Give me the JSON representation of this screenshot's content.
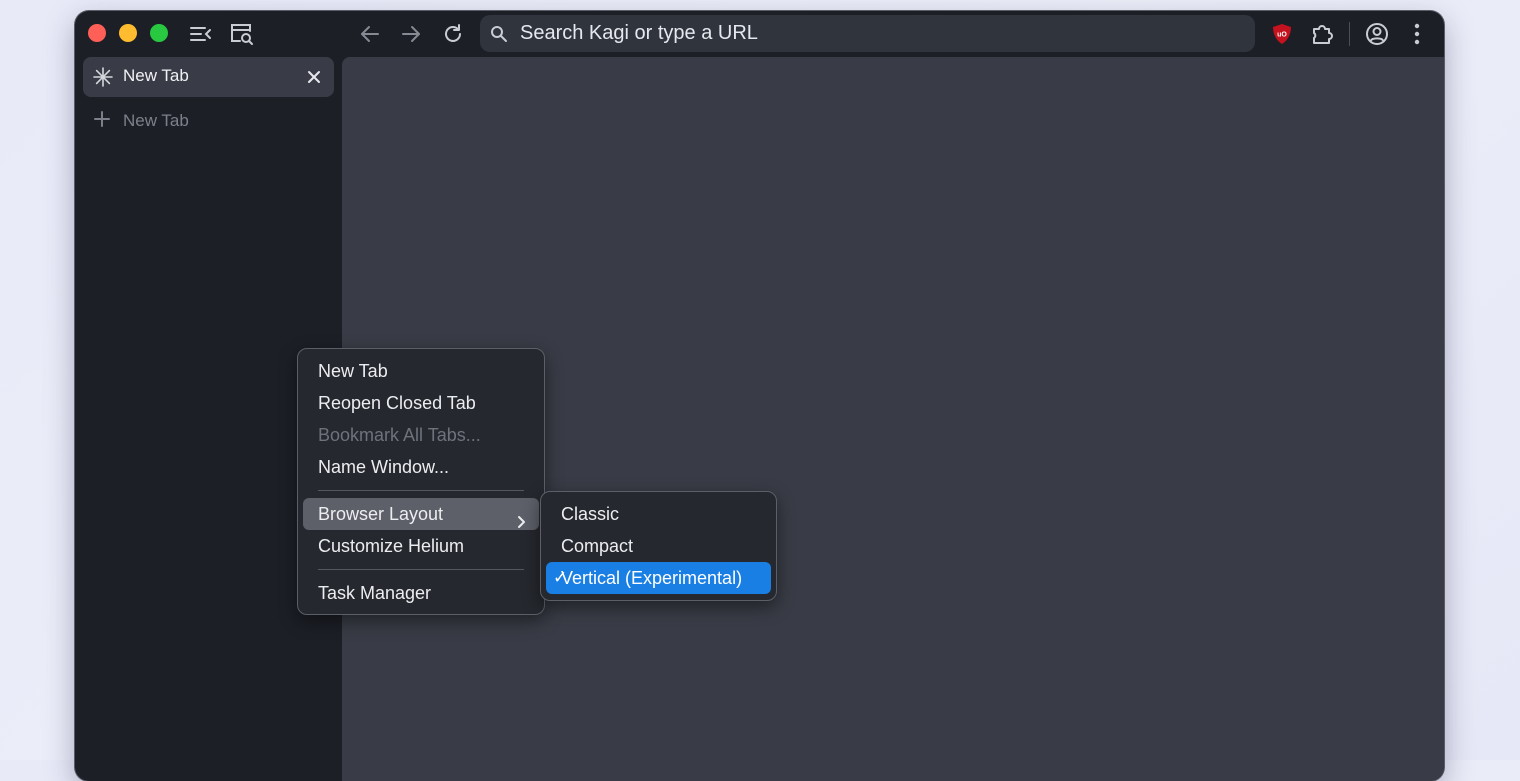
{
  "window": {
    "traffic_lights": {
      "close": "#fe5f57",
      "minimize": "#febc2e",
      "maximize": "#28c840"
    }
  },
  "toolbar": {
    "icons": [
      "sidebar-toggle-icon",
      "tab-search-icon",
      "back-arrow-icon",
      "forward-arrow-icon",
      "reload-icon",
      "ublock-origin-icon",
      "extensions-puzzle-icon",
      "profile-icon",
      "more-vert-icon"
    ],
    "url_placeholder": "Search Kagi or type a URL",
    "ublock_color": "#c4121f"
  },
  "sidebar": {
    "tabs": [
      {
        "title": "New Tab",
        "icon": "helium-asterisk-icon",
        "active": true
      }
    ],
    "new_tab_label": "New Tab"
  },
  "context_menu": {
    "items": [
      {
        "label": "New Tab",
        "enabled": true
      },
      {
        "label": "Reopen Closed Tab",
        "enabled": true
      },
      {
        "label": "Bookmark All Tabs...",
        "enabled": false
      },
      {
        "label": "Name Window...",
        "enabled": true
      },
      {
        "label": "Browser Layout",
        "enabled": true,
        "submenu": true,
        "highlighted": true
      },
      {
        "label": "Customize Helium",
        "enabled": true
      },
      {
        "label": "Task Manager",
        "enabled": true
      }
    ]
  },
  "layout_submenu": {
    "items": [
      {
        "label": "Classic",
        "checked": false
      },
      {
        "label": "Compact",
        "checked": false
      },
      {
        "label": "Vertical (Experimental)",
        "checked": true
      }
    ],
    "check_mark": "✓",
    "selected_color": "#1a7fe5"
  }
}
